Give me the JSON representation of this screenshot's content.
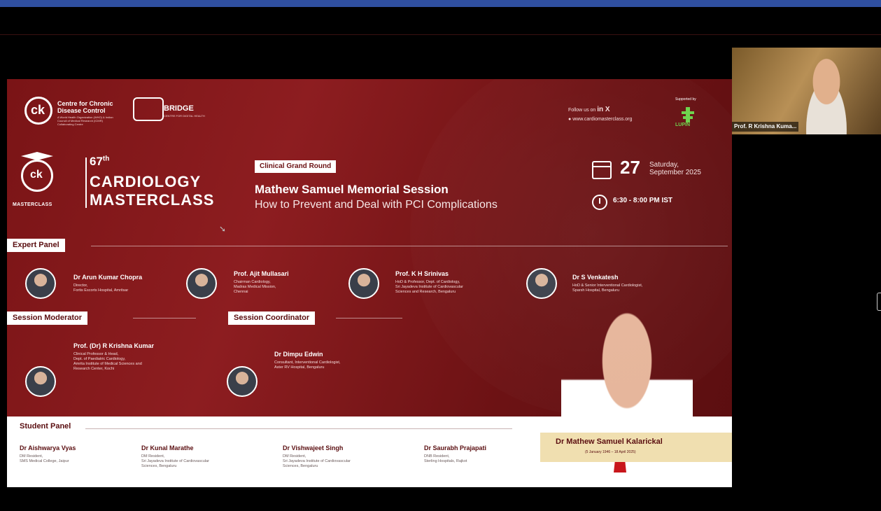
{
  "slide": {
    "org_name": "Centre for Chronic Disease Control",
    "org_sub": "A World Health Organization (WHO) & Indian Council of Medical Research (ICMR) Collaborating Centre",
    "bridge_name": "BRIDGE",
    "bridge_sub": "CENTRE FOR DIGITAL HEALTH",
    "follow_text": "Follow us on",
    "follow_icons": "in X",
    "website": "www.cardiomasterclass.org",
    "supported_by": "Supported by",
    "lupin": "LUPIN",
    "masterclass_label": "MASTERCLASS",
    "edition_num": "67",
    "edition_sup": "th",
    "cardiology": "CARDIOLOGY",
    "masterclass": "MASTERCLASS",
    "grand_round": "Clinical Grand Round",
    "session_title": "Mathew Samuel Memorial Session",
    "session_sub": "How to Prevent and Deal with PCI Complications",
    "day": "27",
    "weekday": "Saturday,",
    "monthyear": "September 2025",
    "time": "6:30 - 8:00 PM IST",
    "expert_panel_label": "Expert Panel",
    "experts": [
      {
        "name": "Dr Arun Kumar Chopra",
        "desc1": "Director,",
        "desc2": "Fortis Escorts Hospital, Amritsar",
        "desc3": ""
      },
      {
        "name": "Prof. Ajit Mullasari",
        "desc1": "Chairman Cardiology,",
        "desc2": "Madras Medical Mission,",
        "desc3": "Chennai"
      },
      {
        "name": "Prof. K H Srinivas",
        "desc1": "HoD & Professor, Dept. of Cardiology,",
        "desc2": "Sri Jayadeva Institute of Cardiovascular",
        "desc3": "Sciences and Research, Bengaluru"
      },
      {
        "name": "Dr S Venkatesh",
        "desc1": "HoD & Senior Interventional Cardiologist,",
        "desc2": "Sparsh Hospital, Bengaluru",
        "desc3": ""
      }
    ],
    "moderator_label": "Session Moderator",
    "moderator": {
      "name": "Prof. (Dr) R Krishna Kumar",
      "desc1": "Clinical Professor & Head,",
      "desc2": "Dept. of Paediatric Cardiology,",
      "desc3": "Amrita Institute of Medical Sciences and",
      "desc4": "Research Center, Kochi"
    },
    "coordinator_label": "Session Coordinator",
    "coordinator": {
      "name": "Dr Dimpu Edwin",
      "desc1": "Consultant, Interventional Cardiologist,",
      "desc2": "Aster RV Hospital, Bengaluru"
    },
    "student_panel_label": "Student Panel",
    "students": [
      {
        "name": "Dr Aishwarya Vyas",
        "desc1": "DM Resident,",
        "desc2": "SMS Medical College, Jaipur",
        "desc3": ""
      },
      {
        "name": "Dr Kunal Marathe",
        "desc1": "DM Resident,",
        "desc2": "Sri Jayadeva Institute of Cardiovascular",
        "desc3": "Sciences, Bengaluru"
      },
      {
        "name": "Dr Vishwajeet Singh",
        "desc1": "DM Resident,",
        "desc2": "Sri Jayadeva Institute of Cardiovascular",
        "desc3": "Sciences, Bengaluru"
      },
      {
        "name": "Dr Saurabh Prajapati",
        "desc1": "DNB Resident,",
        "desc2": "Sterling Hospitals, Rajkot",
        "desc3": ""
      }
    ],
    "memorial_name": "Dr Mathew Samuel Kalarickal",
    "memorial_dates": "(5 January 1946 – 18 April 2025)"
  },
  "video": {
    "participant_name": "Prof. R Krishna Kuma..."
  },
  "colors": {
    "topbar": "#2f4fa0",
    "slide_red": "#8d1d20",
    "banner_gold": "#f0dfb0",
    "lupin_green": "#6cd24a"
  },
  "icons": [
    "calendar-icon",
    "clock-icon",
    "linkedin-icon",
    "x-icon",
    "globe-icon",
    "cursor-icon"
  ]
}
